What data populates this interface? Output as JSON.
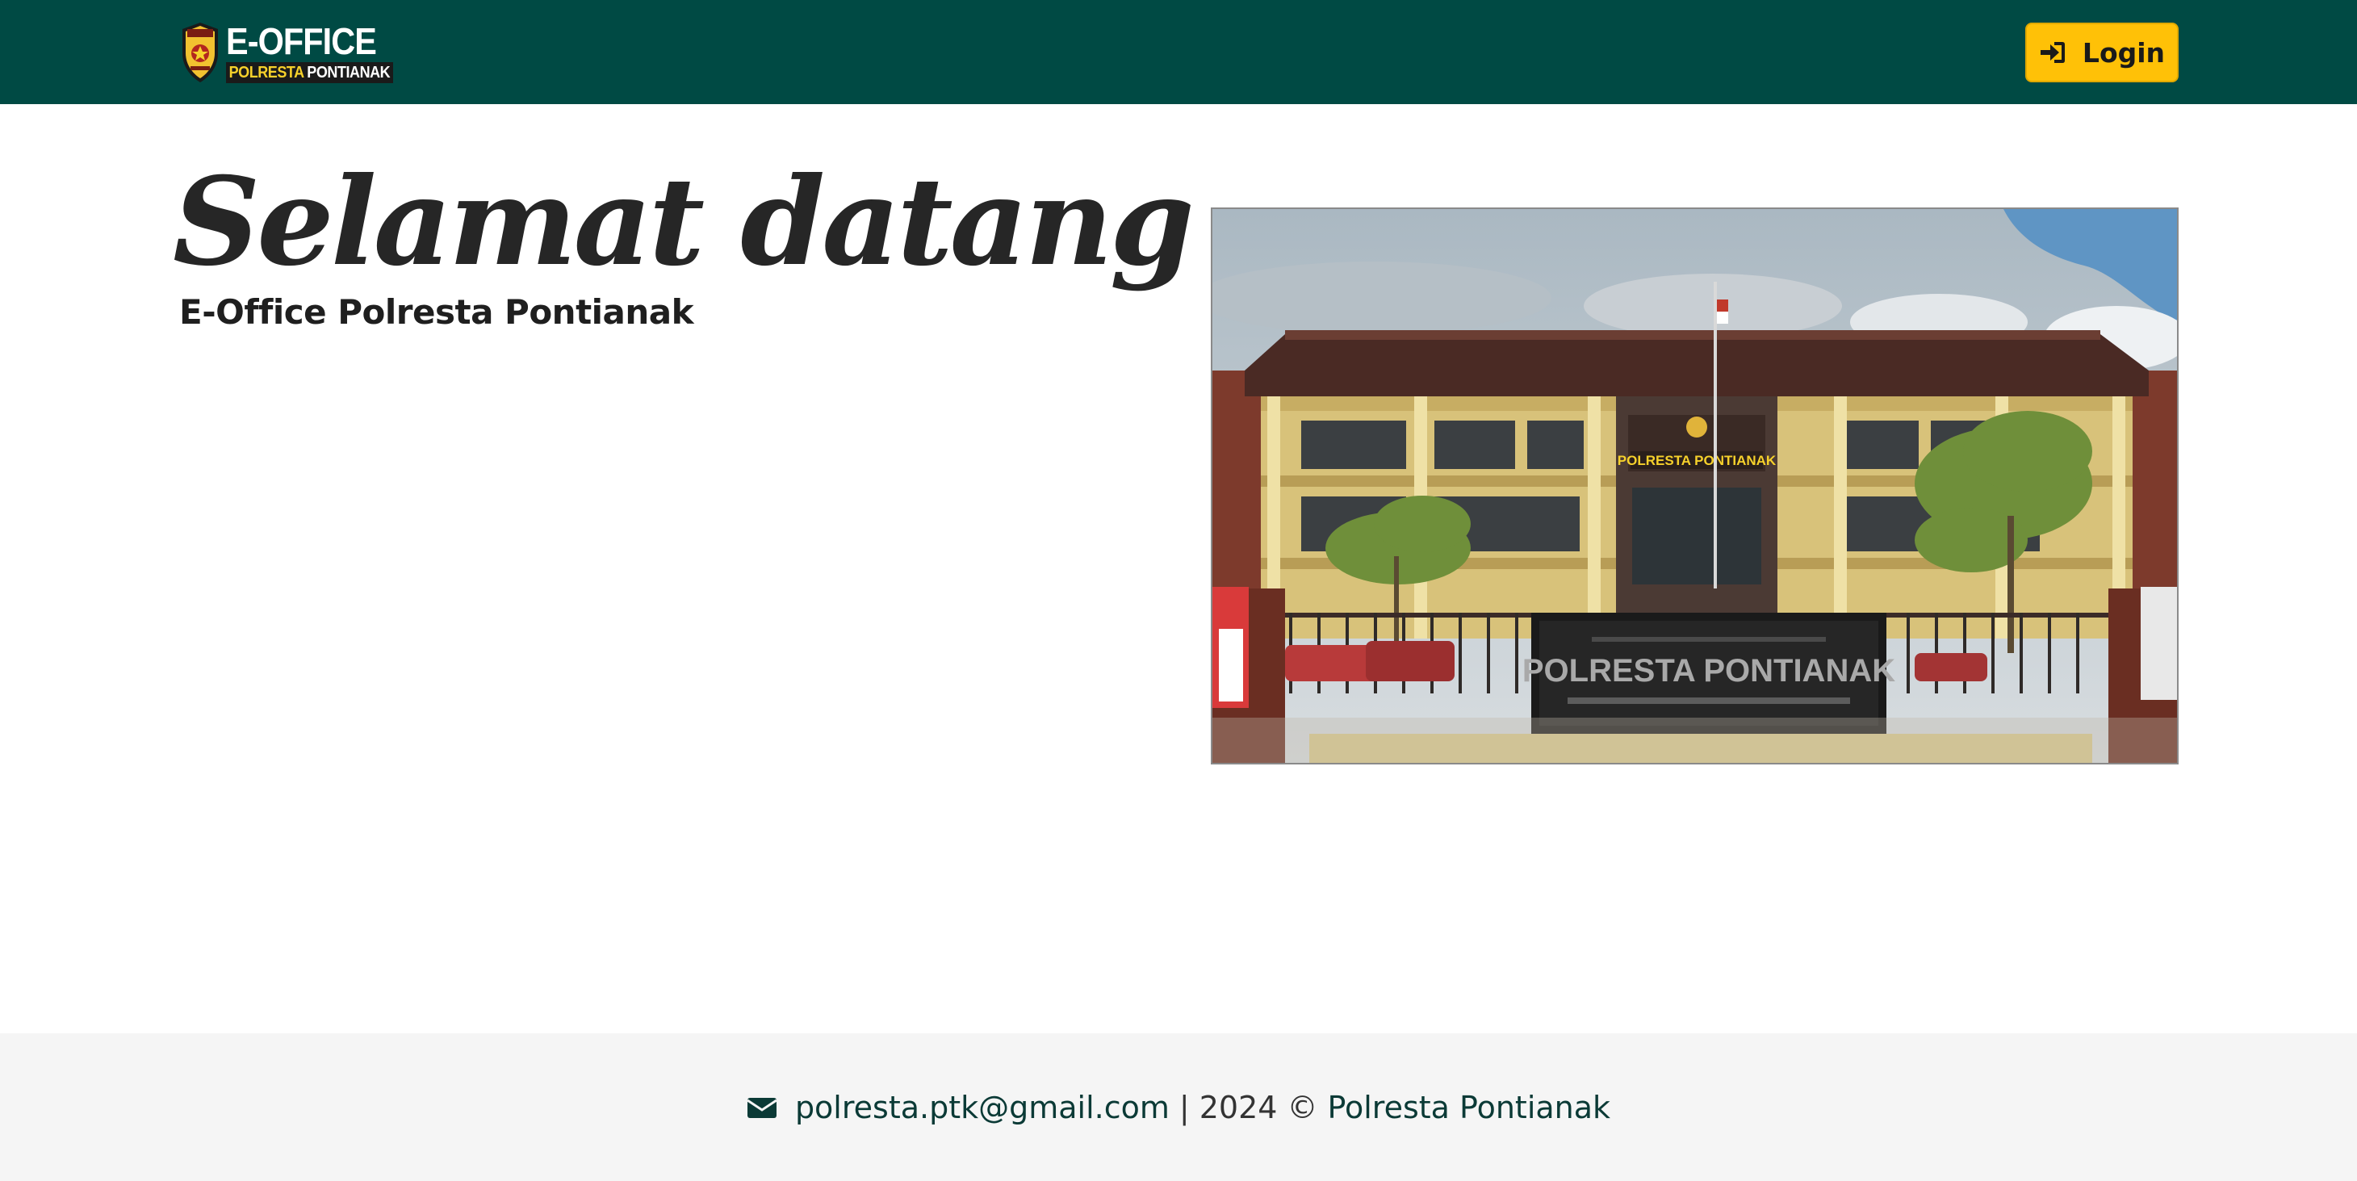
{
  "navbar": {
    "brand": {
      "title": "E-OFFICE",
      "subtitle_part1": "POLRESTA",
      "subtitle_part2": "PONTIANAK",
      "logo_icon": "police-badge-icon"
    },
    "login": {
      "label": "Login",
      "icon": "sign-in-icon"
    },
    "background_color": "#004a44",
    "login_color": "#ffc107"
  },
  "hero": {
    "title": "Selamat datang",
    "subtitle": "E-Office Polresta Pontianak",
    "image": {
      "building_sign": "POLRESTA PONTIANAK",
      "gate_sign": "POLRESTA PONTIANAK"
    }
  },
  "footer": {
    "email_icon": "envelope-icon",
    "email": "polresta.ptk@gmail.com",
    "separator": "|",
    "year": "2024",
    "copyright": "©",
    "organization": "Polresta Pontianak"
  }
}
